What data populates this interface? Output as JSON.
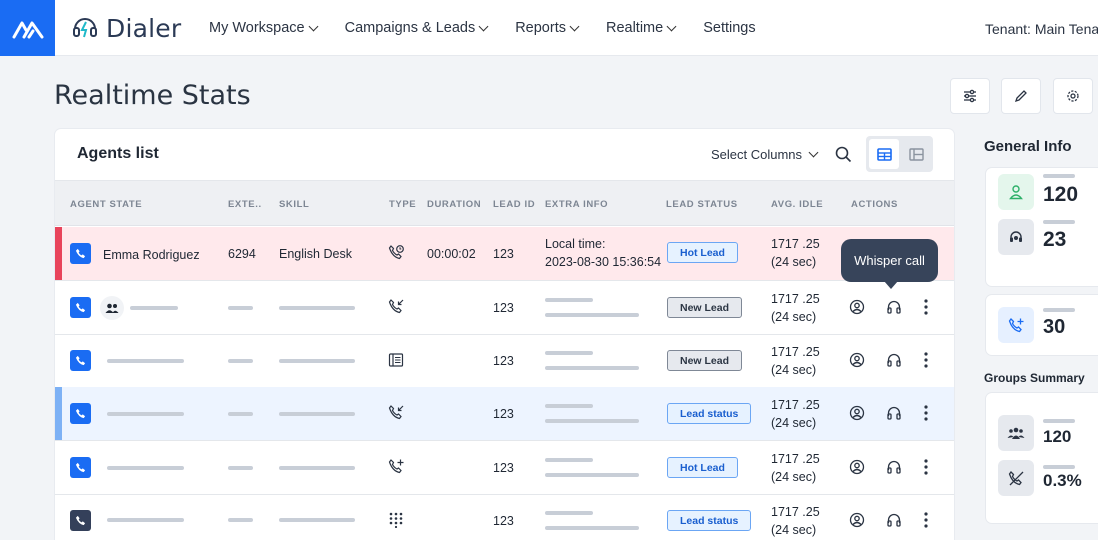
{
  "app": {
    "name": "Dialer",
    "tenant": "Tenant: Main Tenant"
  },
  "nav": [
    {
      "label": "My Workspace",
      "dropdown": true
    },
    {
      "label": "Campaigns & Leads",
      "dropdown": true
    },
    {
      "label": "Reports",
      "dropdown": true
    },
    {
      "label": "Realtime",
      "dropdown": true
    },
    {
      "label": "Settings",
      "dropdown": false
    }
  ],
  "page": {
    "title": "Realtime Stats"
  },
  "toolbar_icons": [
    "sliders-icon",
    "pencil-icon",
    "gear-icon"
  ],
  "agents": {
    "title": "Agents list",
    "select_columns": "Select Columns",
    "columns": [
      "AGENT STATE",
      "EXTE..",
      "SKILL",
      "TYPE",
      "DURATION",
      "LEAD ID",
      "EXTRA INFO",
      "LEAD STATUS",
      "AVG. IDLE",
      "ACTIONS"
    ],
    "rows": [
      {
        "name": "Emma Rodriguez",
        "ext": "6294",
        "skill": "English Desk",
        "type_icon": "phone-clock-icon",
        "duration": "00:00:02",
        "lead_id": "123",
        "extra_info": [
          "Local time:",
          "2023-08-30 15:36:54"
        ],
        "lead_status": "Hot Lead",
        "avg_idle": [
          "1717 .25",
          "(24 sec)"
        ],
        "highlight": "red",
        "phone_color": "#1a6cf3"
      },
      {
        "name": "",
        "ext": "",
        "skill": "",
        "type_icon": "phone-incoming-icon",
        "duration": "",
        "lead_id": "123",
        "extra_info": [],
        "lead_status": "New Lead",
        "avg_idle": [
          "1717 .25",
          "(24 sec)"
        ],
        "highlight": "none",
        "phone_color": "#1a6cf3"
      },
      {
        "name": "",
        "ext": "",
        "skill": "",
        "type_icon": "ledger-icon",
        "duration": "",
        "lead_id": "123",
        "extra_info": [],
        "lead_status": "New Lead",
        "avg_idle": [
          "1717 .25",
          "(24 sec)"
        ],
        "highlight": "none",
        "phone_color": "#1a6cf3"
      },
      {
        "name": "",
        "ext": "",
        "skill": "",
        "type_icon": "phone-incoming-icon",
        "duration": "",
        "lead_id": "123",
        "extra_info": [],
        "lead_status": "Lead status",
        "avg_idle": [
          "1717 .25",
          "(24 sec)"
        ],
        "highlight": "blue",
        "phone_color": "#1a6cf3"
      },
      {
        "name": "",
        "ext": "",
        "skill": "",
        "type_icon": "phone-outgoing-icon",
        "duration": "",
        "lead_id": "123",
        "extra_info": [],
        "lead_status": "Hot Lead",
        "avg_idle": [
          "1717 .25",
          "(24 sec)"
        ],
        "highlight": "none",
        "phone_color": "#1a6cf3"
      },
      {
        "name": "",
        "ext": "",
        "skill": "",
        "type_icon": "dialpad-icon",
        "duration": "",
        "lead_id": "123",
        "extra_info": [],
        "lead_status": "Lead status",
        "avg_idle": [
          "1717 .25",
          "(24 sec)"
        ],
        "highlight": "none",
        "phone_color": "#34405a"
      }
    ],
    "tooltip": "Whisper call"
  },
  "general_info": {
    "title": "General Info",
    "stats": [
      {
        "icon": "user-icon",
        "value": "120"
      },
      {
        "icon": "headset-icon",
        "value": "23"
      },
      {
        "icon": "phone-add-icon",
        "value": "30"
      }
    ]
  },
  "groups_summary": {
    "title": "Groups Summary",
    "stats": [
      {
        "icon": "group-icon",
        "value": "120"
      },
      {
        "icon": "phone-missed-icon",
        "value": "0.3%"
      }
    ]
  },
  "colors": {
    "brand": "#1a6cf3",
    "hot_row": "#ffe9ec",
    "hot_accent": "#e8445b",
    "selected_row": "#edf4ff",
    "selected_accent": "#7db1f5"
  }
}
